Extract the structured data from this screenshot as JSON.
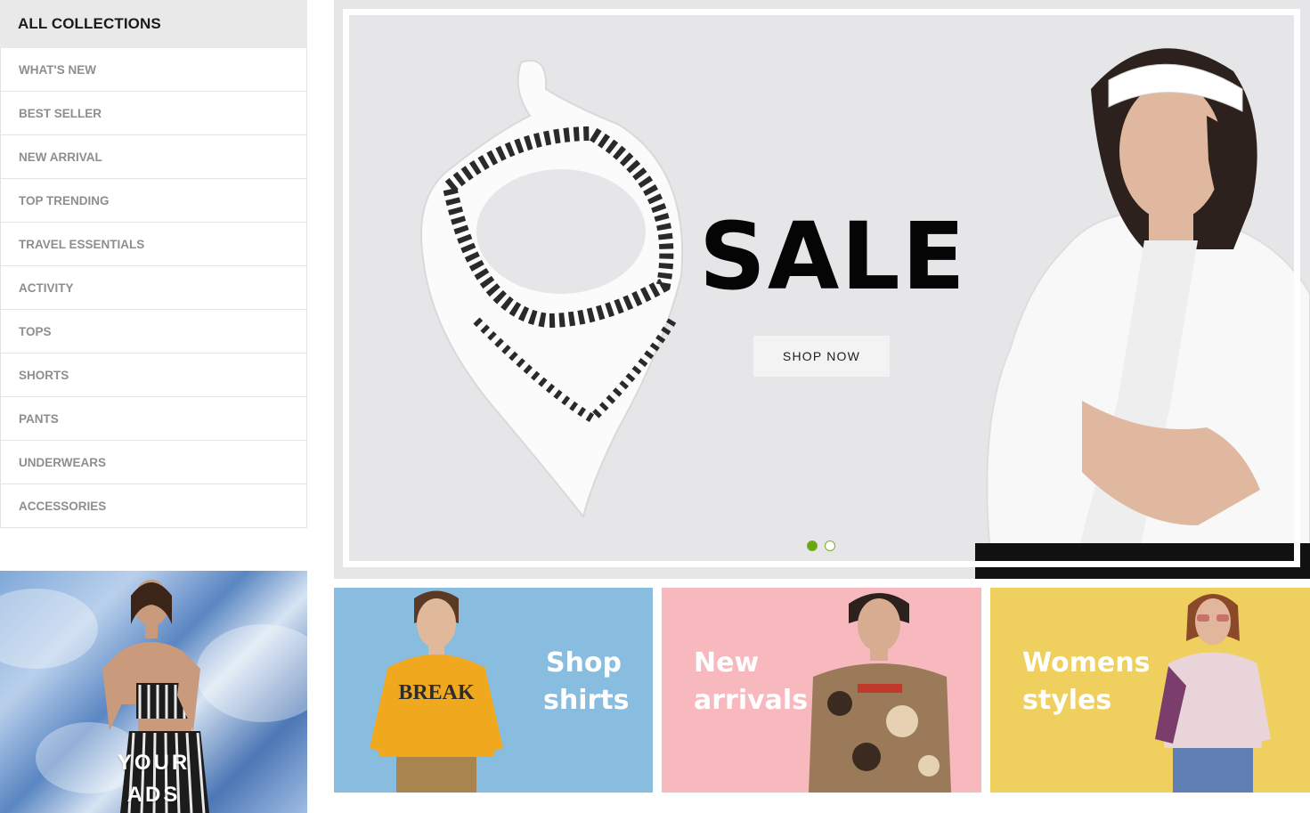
{
  "sidebar": {
    "title": "ALL COLLECTIONS",
    "items": [
      {
        "label": "WHAT'S NEW"
      },
      {
        "label": "BEST SELLER"
      },
      {
        "label": "NEW ARRIVAL"
      },
      {
        "label": "TOP TRENDING"
      },
      {
        "label": "TRAVEL ESSENTIALS"
      },
      {
        "label": "ACTIVITY"
      },
      {
        "label": "TOPS"
      },
      {
        "label": "SHORTS"
      },
      {
        "label": "PANTS"
      },
      {
        "label": "UNDERWEARS"
      },
      {
        "label": "ACCESSORIES"
      }
    ]
  },
  "ad": {
    "line1": "YOUR",
    "line2": "ADS"
  },
  "hero": {
    "title": "SALE",
    "button_label": "SHOP NOW",
    "slide_count": 2,
    "active_slide": 1,
    "colors": {
      "dot_active": "#6aa612",
      "background": "#e6e6e8"
    }
  },
  "cards": [
    {
      "line1": "Shop",
      "line2": "shirts",
      "bg": "#89bde0"
    },
    {
      "line1": "New",
      "line2": "arrivals",
      "bg": "#f7b9bd"
    },
    {
      "line1": "Womens",
      "line2": "styles",
      "bg": "#efcf5e"
    }
  ]
}
